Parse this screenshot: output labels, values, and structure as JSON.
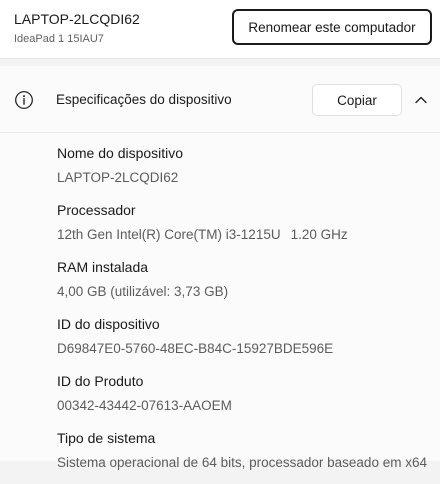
{
  "device": {
    "name": "LAPTOP-2LCQDI62",
    "model": "IdeaPad 1 15IAU7"
  },
  "buttons": {
    "rename": "Renomear este computador",
    "copy": "Copiar"
  },
  "specs": {
    "title": "Especificações do dispositivo",
    "device_name_label": "Nome do dispositivo",
    "device_name_value": "LAPTOP-2LCQDI62",
    "processor_label": "Processador",
    "processor_value": "12th Gen Intel(R) Core(TM) i3-1215U",
    "processor_speed": "1.20 GHz",
    "ram_label": "RAM instalada",
    "ram_value": "4,00 GB (utilizável: 3,73 GB)",
    "device_id_label": "ID do dispositivo",
    "device_id_value": "D69847E0-5760-48EC-B84C-15927BDE596E",
    "product_id_label": "ID do Produto",
    "product_id_value": "00342-43442-07613-AAOEM",
    "system_type_label": "Tipo de sistema",
    "system_type_value": "Sistema operacional de 64 bits, processador baseado em x64"
  },
  "icons": {
    "info": "info-icon",
    "collapse": "chevron-up-icon"
  },
  "colors": {
    "page_bg": "#f3f3f3",
    "card_bg": "#ffffff",
    "primary_text": "#1a1a1a",
    "secondary_text": "#5c5c5c"
  }
}
